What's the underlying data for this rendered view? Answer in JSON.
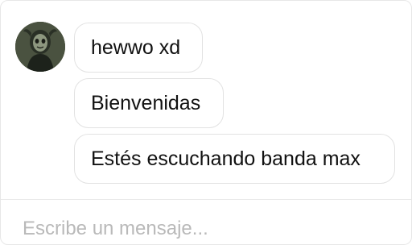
{
  "chat": {
    "messages": [
      {
        "text": "hewwo xd"
      },
      {
        "text": "Bienvenidas"
      },
      {
        "text": "Estés escuchando banda max"
      }
    ]
  },
  "composer": {
    "placeholder": "Escribe un mensaje..."
  },
  "icons": {
    "avatar": "user-avatar-icon"
  },
  "colors": {
    "bubble_border": "#e2e2e2",
    "placeholder": "#b9b9b9",
    "text": "#111111"
  }
}
